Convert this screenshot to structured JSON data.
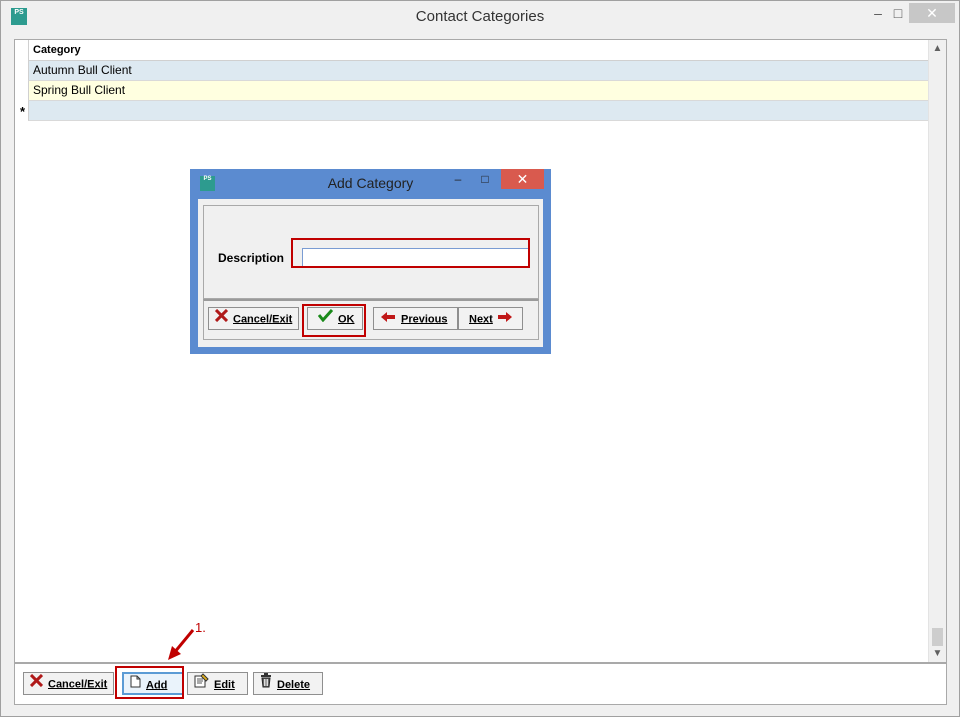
{
  "window": {
    "title": "Contact Categories",
    "app_icon_text": "PS",
    "controls": {
      "minimize": "–",
      "maximize": "□",
      "close": "✕"
    }
  },
  "grid": {
    "header": "Category",
    "rows": [
      "Autumn Bull Client",
      "Spring Bull Client"
    ],
    "new_row_marker": "*"
  },
  "footer_buttons": {
    "cancel": "Cancel/Exit",
    "add": "Add",
    "edit": "Edit",
    "delete": "Delete"
  },
  "annotation": {
    "step_label": "1."
  },
  "dialog": {
    "title": "Add Category",
    "app_icon_text": "PS",
    "description_label": "Description",
    "description_value": "",
    "buttons": {
      "cancel": "Cancel/Exit",
      "ok": "OK",
      "previous": "Previous",
      "next": "Next"
    }
  },
  "colors": {
    "accent_red": "#c00000",
    "dialog_frame": "#5b8bd0",
    "row_alt_blue": "#dde9f1",
    "row_selected_yellow": "#ffffe0"
  }
}
